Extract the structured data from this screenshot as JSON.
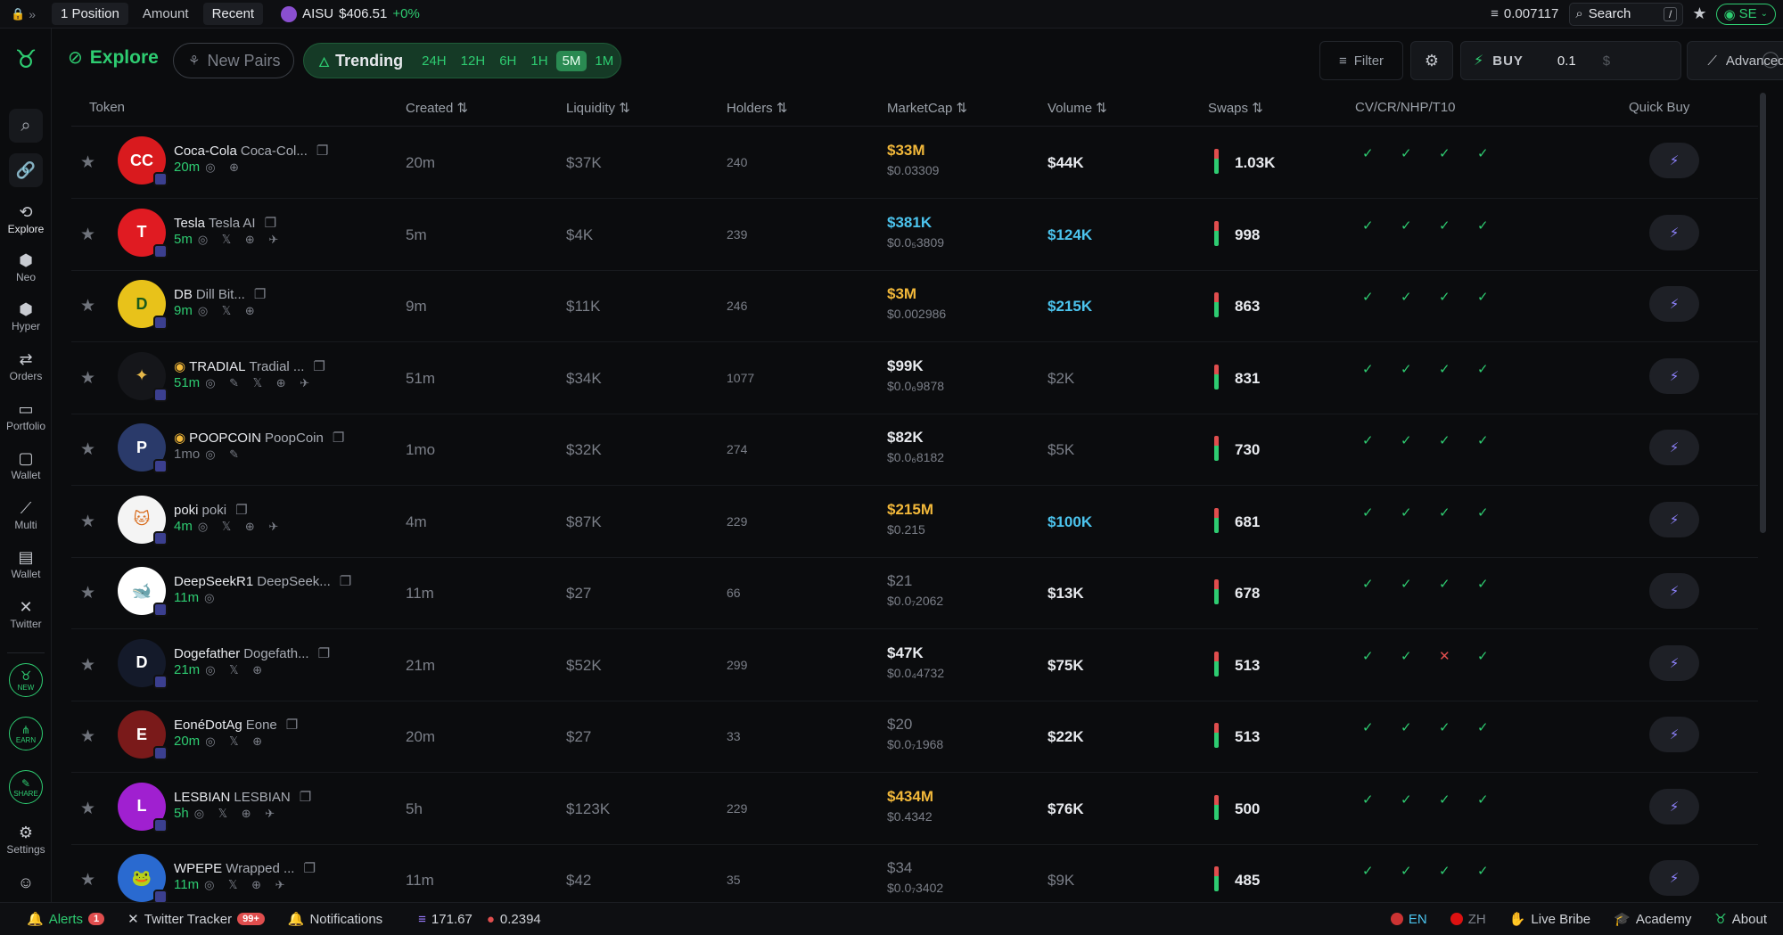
{
  "topbar": {
    "tabs": [
      "1 Position",
      "Amount",
      "Recent"
    ],
    "ticker_symbol": "AISU",
    "ticker_price": "$406.51",
    "ticker_change": "+0%",
    "balance": "0.007117",
    "search_label": "Search",
    "search_shortcut": "/",
    "profile_label": "SE"
  },
  "sidebar": {
    "items": [
      {
        "label": "Explore",
        "icon": "explore-icon"
      },
      {
        "label": "Neo",
        "icon": "neo-icon"
      },
      {
        "label": "Hyper",
        "icon": "hyper-icon"
      },
      {
        "label": "Orders",
        "icon": "orders-icon"
      },
      {
        "label": "Portfolio",
        "icon": "portfolio-icon"
      },
      {
        "label": "Wallet",
        "icon": "wallet-icon"
      },
      {
        "label": "Multi",
        "icon": "chart-icon"
      },
      {
        "label": "Wallet",
        "icon": "document-icon"
      },
      {
        "label": "Twitter",
        "icon": "x-icon"
      }
    ],
    "badges": [
      "NEW",
      "EARN",
      "SHARE"
    ],
    "settings_label": "Settings"
  },
  "header": {
    "explore_label": "Explore",
    "new_pairs_label": "New Pairs",
    "trending_label": "Trending",
    "timeframes": [
      "24H",
      "12H",
      "6H",
      "1H",
      "5M",
      "1M"
    ],
    "active_timeframe": "5M",
    "filter_label": "Filter",
    "buy_label": "BUY",
    "buy_amount": "0.1",
    "buy_currency": "$",
    "advanced_label": "Advanced"
  },
  "table": {
    "columns": {
      "token": "Token",
      "created": "Created",
      "liquidity": "Liquidity",
      "holders": "Holders",
      "marketcap": "MarketCap",
      "volume": "Volume",
      "swaps": "Swaps",
      "checks": "CV/CR/NHP/T10",
      "quickbuy": "Quick Buy"
    },
    "rows": [
      {
        "symbol": "Coca-Cola",
        "name": "Coca-Col...",
        "age": "20m",
        "socials": "◎ ⊕",
        "created": "20m",
        "liquidity": "$37K",
        "holders": "240",
        "mcap": "$33M",
        "mcap_color": "gold",
        "price": "$0.03309",
        "volume": "$44K",
        "vol_color": "white",
        "swaps": "1.03K",
        "checks": [
          "✓",
          "✓",
          "✓",
          "✓"
        ],
        "avatar_bg": "#d91a1e",
        "avatar_fg": "#fff",
        "avatar_text": "CC",
        "badge": ""
      },
      {
        "symbol": "Tesla",
        "name": "Tesla AI",
        "age": "5m",
        "socials": "◎ 𝕏 ⊕ ✈",
        "created": "5m",
        "liquidity": "$4K",
        "holders": "239",
        "mcap": "$381K",
        "mcap_color": "cyan",
        "price": "$0.0₅3809",
        "volume": "$124K",
        "vol_color": "cyan",
        "swaps": "998",
        "checks": [
          "✓",
          "✓",
          "✓",
          "✓"
        ],
        "avatar_bg": "#e01b22",
        "avatar_fg": "#fff",
        "avatar_text": "T",
        "badge": ""
      },
      {
        "symbol": "DB",
        "name": "Dill Bit...",
        "age": "9m",
        "socials": "◎ 𝕏 ⊕",
        "created": "9m",
        "liquidity": "$11K",
        "holders": "246",
        "mcap": "$3M",
        "mcap_color": "gold",
        "price": "$0.002986",
        "volume": "$215K",
        "vol_color": "cyan",
        "swaps": "863",
        "checks": [
          "✓",
          "✓",
          "✓",
          "✓"
        ],
        "avatar_bg": "#e8c21a",
        "avatar_fg": "#1a5a1a",
        "avatar_text": "D",
        "badge": ""
      },
      {
        "symbol": "TRADIAL",
        "name": "Tradial ...",
        "age": "51m",
        "socials": "◎ ✎ 𝕏 ⊕ ✈",
        "created": "51m",
        "liquidity": "$34K",
        "holders": "1077",
        "mcap": "$99K",
        "mcap_color": "white",
        "price": "$0.0₆9878",
        "volume": "$2K",
        "vol_color": "dim",
        "swaps": "831",
        "checks": [
          "✓",
          "✓",
          "✓",
          "✓"
        ],
        "avatar_bg": "#15161a",
        "avatar_fg": "#e6b84a",
        "avatar_text": "✦",
        "badge": "◉"
      },
      {
        "symbol": "POOPCOIN",
        "name": "PoopCoin",
        "age": "1mo",
        "socials": "◎ ✎",
        "created": "1mo",
        "liquidity": "$32K",
        "holders": "274",
        "mcap": "$82K",
        "mcap_color": "white",
        "price": "$0.0₆8182",
        "volume": "$5K",
        "vol_color": "dim",
        "swaps": "730",
        "checks": [
          "✓",
          "✓",
          "✓",
          "✓"
        ],
        "avatar_bg": "#2a3a6a",
        "avatar_fg": "#fff",
        "avatar_text": "P",
        "badge": "◉"
      },
      {
        "symbol": "poki",
        "name": "poki",
        "age": "4m",
        "socials": "◎ 𝕏 ⊕ ✈",
        "created": "4m",
        "liquidity": "$87K",
        "holders": "229",
        "mcap": "$215M",
        "mcap_color": "gold",
        "price": "$0.215",
        "volume": "$100K",
        "vol_color": "cyan",
        "swaps": "681",
        "checks": [
          "✓",
          "✓",
          "✓",
          "✓"
        ],
        "avatar_bg": "#f4f4f4",
        "avatar_fg": "#d86a1a",
        "avatar_text": "🐱",
        "badge": ""
      },
      {
        "symbol": "DeepSeekR1",
        "name": "DeepSeek...",
        "age": "11m",
        "socials": "◎",
        "created": "11m",
        "liquidity": "$27",
        "holders": "66",
        "mcap": "$21",
        "mcap_color": "dim",
        "price": "$0.0₇2062",
        "volume": "$13K",
        "vol_color": "white",
        "swaps": "678",
        "checks": [
          "✓",
          "✓",
          "✓",
          "✓"
        ],
        "avatar_bg": "#ffffff",
        "avatar_fg": "#3a66e0",
        "avatar_text": "🐋",
        "badge": ""
      },
      {
        "symbol": "Dogefather",
        "name": "Dogefath...",
        "age": "21m",
        "socials": "◎ 𝕏 ⊕",
        "created": "21m",
        "liquidity": "$52K",
        "holders": "299",
        "mcap": "$47K",
        "mcap_color": "white",
        "price": "$0.0₄4732",
        "volume": "$75K",
        "vol_color": "white",
        "swaps": "513",
        "checks": [
          "✓",
          "✓",
          "✕",
          "✓"
        ],
        "avatar_bg": "#141a2a",
        "avatar_fg": "#fff",
        "avatar_text": "D",
        "badge": ""
      },
      {
        "symbol": "EonéDotAg",
        "name": "Eone",
        "age": "20m",
        "socials": "◎ 𝕏 ⊕",
        "created": "20m",
        "liquidity": "$27",
        "holders": "33",
        "mcap": "$20",
        "mcap_color": "dim",
        "price": "$0.0₇1968",
        "volume": "$22K",
        "vol_color": "white",
        "swaps": "513",
        "checks": [
          "✓",
          "✓",
          "✓",
          "✓"
        ],
        "avatar_bg": "#7a1a1a",
        "avatar_fg": "#fff",
        "avatar_text": "E",
        "badge": ""
      },
      {
        "symbol": "LESBIAN",
        "name": "LESBIAN",
        "age": "5h",
        "socials": "◎ 𝕏 ⊕ ✈",
        "created": "5h",
        "liquidity": "$123K",
        "holders": "229",
        "mcap": "$434M",
        "mcap_color": "gold",
        "price": "$0.4342",
        "volume": "$76K",
        "vol_color": "white",
        "swaps": "500",
        "checks": [
          "✓",
          "✓",
          "✓",
          "✓"
        ],
        "avatar_bg": "#a020d0",
        "avatar_fg": "#fff",
        "avatar_text": "L",
        "badge": ""
      },
      {
        "symbol": "WPEPE",
        "name": "Wrapped ...",
        "age": "11m",
        "socials": "◎ 𝕏 ⊕ ✈",
        "created": "11m",
        "liquidity": "$42",
        "holders": "35",
        "mcap": "$34",
        "mcap_color": "dim",
        "price": "$0.0₇3402",
        "volume": "$9K",
        "vol_color": "dim",
        "swaps": "485",
        "checks": [
          "✓",
          "✓",
          "✓",
          "✓"
        ],
        "avatar_bg": "#2a6ad0",
        "avatar_fg": "#7adf4a",
        "avatar_text": "🐸",
        "badge": ""
      }
    ]
  },
  "bottombar": {
    "alerts_label": "Alerts",
    "alerts_count": "1",
    "twitter_tracker_label": "Twitter Tracker",
    "twitter_tracker_count": "99+",
    "notifications_label": "Notifications",
    "sol_price": "171.67",
    "other_price": "0.2394",
    "lang_en": "EN",
    "lang_zh": "ZH",
    "live_bribe_label": "Live Bribe",
    "academy_label": "Academy",
    "about_label": "About"
  },
  "colors": {
    "accent_green": "#2ecc71",
    "gold": "#f2b83a",
    "cyan": "#4cc4ee",
    "red": "#e04e4e",
    "background": "#0b0c0e"
  }
}
